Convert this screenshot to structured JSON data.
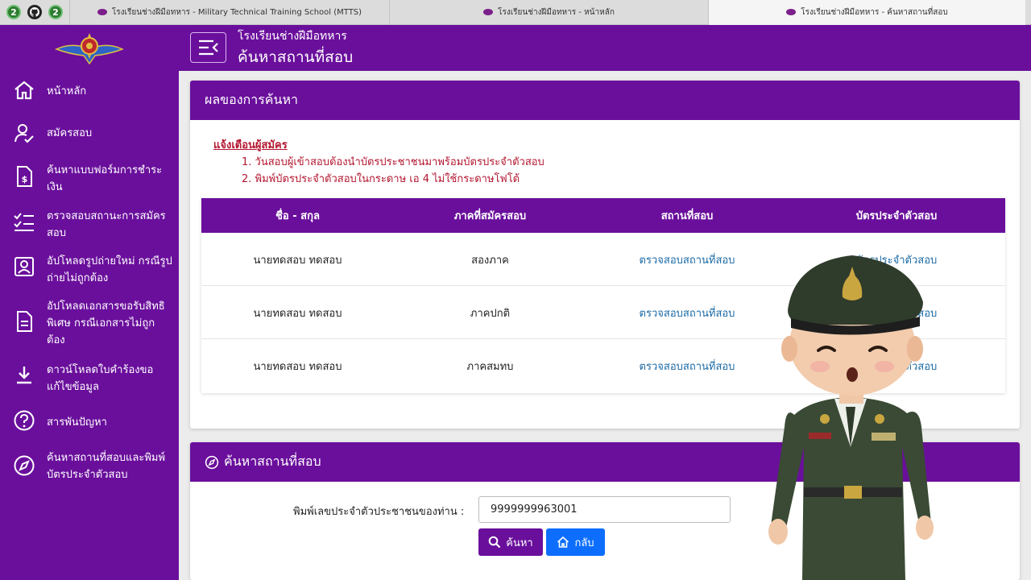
{
  "browser": {
    "tabs": [
      {
        "title": "โรงเรียนช่างฝีมือทหาร - Military Technical Training School (MTTS)"
      },
      {
        "title": "โรงเรียนช่างฝีมือทหาร - หน้าหลัก"
      },
      {
        "title": "โรงเรียนช่างฝีมือทหาร - ค้นหาสถานที่สอบ"
      }
    ],
    "badge_count": "2"
  },
  "header": {
    "school_name": "โรงเรียนช่างฝีมือทหาร",
    "page_title": "ค้นหาสถานที่สอบ"
  },
  "sidebar": {
    "items": [
      {
        "label": "หน้าหลัก",
        "icon": "home-icon"
      },
      {
        "label": "สมัครสอบ",
        "icon": "user-check-icon"
      },
      {
        "label": "ค้นหาแบบฟอร์มการชำระเงิน",
        "icon": "invoice-icon"
      },
      {
        "label": "ตรวจสอบสถานะการสมัครสอบ",
        "icon": "checklist-icon"
      },
      {
        "label": "อัปโหลดรูปถ่ายใหม่ กรณีรูปถ่ายไม่ถูกต้อง",
        "icon": "id-card-icon"
      },
      {
        "label": "อัปโหลดเอกสารขอรับสิทธิพิเศษ กรณีเอกสารไม่ถูกต้อง",
        "icon": "document-icon"
      },
      {
        "label": "ดาวน์โหลดใบคำร้องขอแก้ไขข้อมูล",
        "icon": "download-icon"
      },
      {
        "label": "สารพันปัญหา",
        "icon": "help-icon"
      },
      {
        "label": "ค้นหาสถานที่สอบและพิมพ์บัตรประจำตัวสอบ",
        "icon": "compass-icon"
      }
    ]
  },
  "results": {
    "title": "ผลของการค้นหา",
    "notice_title": "แจ้งเตือนผู้สมัคร",
    "notices": [
      "1. วันสอบผู้เข้าสอบต้องนำบัตรประชาชนมาพร้อมบัตรประจำตัวสอบ",
      "2. พิมพ์บัตรประจำตัวสอบในกระดาษ เอ 4 ไม่ใช้กระดาษโฟโต้"
    ],
    "columns": [
      "ชื่อ - สกุล",
      "ภาคที่สมัครสอบ",
      "สถานที่สอบ",
      "บัตรประจำตัวสอบ"
    ],
    "rows": [
      {
        "name": "นายทดสอบ ทดสอบ",
        "section": "สองภาค",
        "location": "ตรวจสอบสถานที่สอบ",
        "card": "บัตรประจำตัวสอบ"
      },
      {
        "name": "นายทดสอบ ทดสอบ",
        "section": "ภาคปกติ",
        "location": "ตรวจสอบสถานที่สอบ",
        "card": "บัตรประจำตัวสอบ"
      },
      {
        "name": "นายทดสอบ ทดสอบ",
        "section": "ภาคสมทบ",
        "location": "ตรวจสอบสถานที่สอบ",
        "card": "บัตรประจำตัวสอบ"
      }
    ]
  },
  "search": {
    "title": "ค้นหาสถานที่สอบ",
    "field_label": "พิมพ์เลขประจำตัวประชาชนของท่าน :",
    "field_value": "9999999963001",
    "search_label": "ค้นหา",
    "back_label": "กลับ"
  },
  "colors": {
    "primary": "#6a0f9c",
    "notice": "#b3162f",
    "link": "#1b6aa5",
    "button_search": "#6a0f9c",
    "button_back": "#0d6efd"
  }
}
